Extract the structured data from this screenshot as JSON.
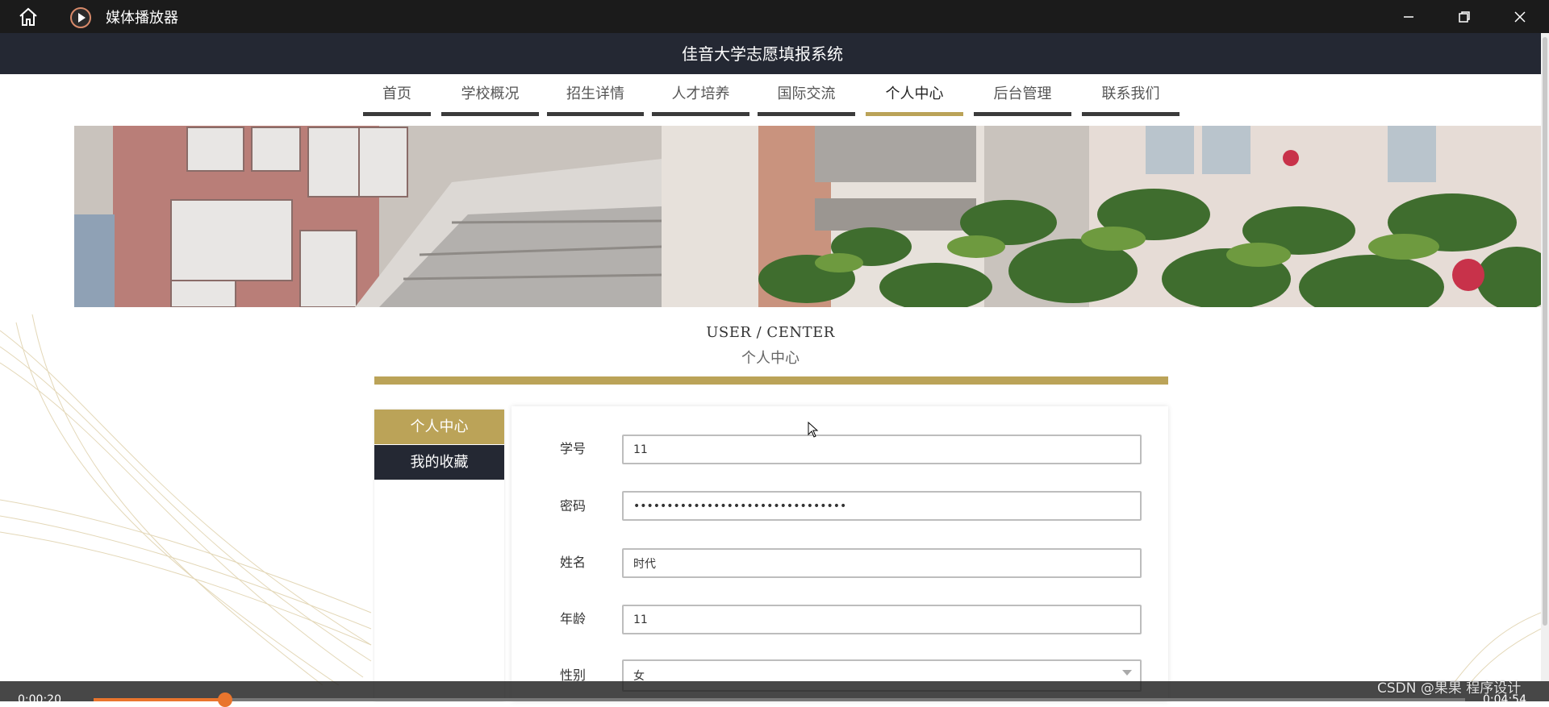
{
  "player": {
    "title": "媒体播放器",
    "time_current": "0:00:20",
    "time_total": "0:04:54",
    "progress_fraction": 0.068
  },
  "site": {
    "title": "佳音大学志愿填报系统"
  },
  "nav": {
    "items": [
      {
        "label": "首页",
        "active": false
      },
      {
        "label": "学校概况",
        "active": false
      },
      {
        "label": "招生详情",
        "active": false
      },
      {
        "label": "人才培养",
        "active": false
      },
      {
        "label": "国际交流",
        "active": false
      },
      {
        "label": "个人中心",
        "active": true
      },
      {
        "label": "后台管理",
        "active": false
      },
      {
        "label": "联系我们",
        "active": false
      }
    ]
  },
  "section": {
    "en": "USER / CENTER",
    "cn": "个人中心"
  },
  "side_menu": {
    "items": [
      "个人中心",
      "我的收藏"
    ]
  },
  "form": {
    "student_id": {
      "label": "学号",
      "value": "11"
    },
    "password": {
      "label": "密码",
      "value": "••••••••••••••••••••••••••••••••"
    },
    "name": {
      "label": "姓名",
      "value": "时代"
    },
    "age": {
      "label": "年龄",
      "value": "11"
    },
    "gender": {
      "label": "性别",
      "value": "女"
    }
  },
  "watermark": "CSDN @果果 程序设计",
  "colors": {
    "accent_gold": "#bba358",
    "header_dark": "#242833",
    "progress_orange": "#e9752d"
  }
}
